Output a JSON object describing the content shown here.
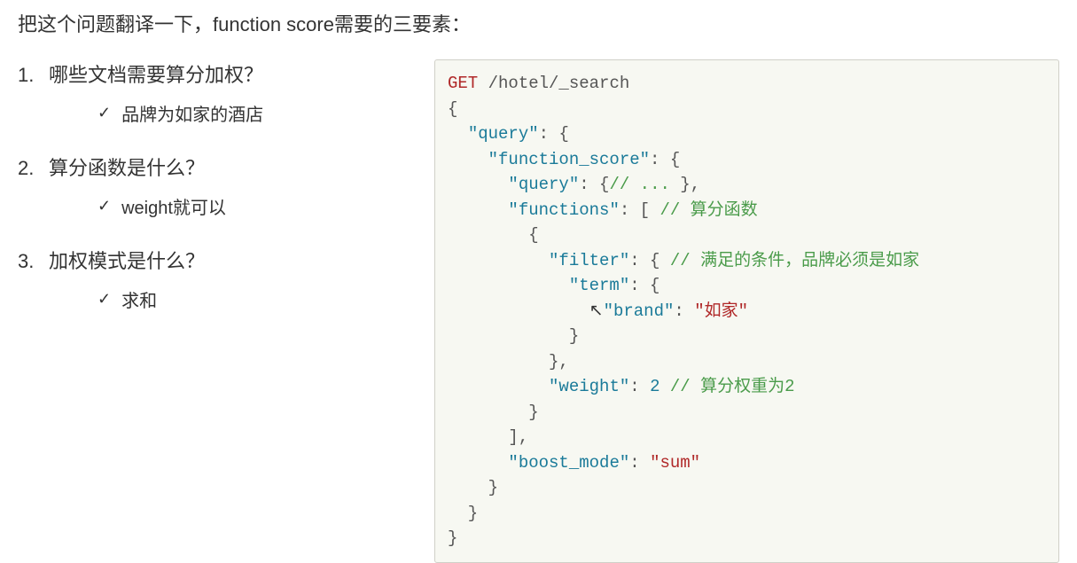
{
  "title": "把这个问题翻译一下，function score需要的三要素：",
  "list": [
    {
      "num": "1.",
      "text": "哪些文档需要算分加权？",
      "sub": "品牌为如家的酒店"
    },
    {
      "num": "2.",
      "text": "算分函数是什么？",
      "sub": "weight就可以"
    },
    {
      "num": "3.",
      "text": "加权模式是什么？",
      "sub": "求和"
    }
  ],
  "code": {
    "l1_method": "GET",
    "l1_path": " /hotel/_search",
    "l2": "{",
    "l3_pre": "  ",
    "l3_key": "\"query\"",
    "l3_post": ": {",
    "l4_pre": "    ",
    "l4_key": "\"function_score\"",
    "l4_post": ": {",
    "l5_pre": "      ",
    "l5_key": "\"query\"",
    "l5_mid": ": {",
    "l5_comment": "// ...",
    "l5_end": " },",
    "l6_pre": "      ",
    "l6_key": "\"functions\"",
    "l6_mid": ": [ ",
    "l6_comment": "// 算分函数",
    "l7": "        {",
    "l8_pre": "          ",
    "l8_key": "\"filter\"",
    "l8_mid": ": { ",
    "l8_comment": "// 满足的条件，品牌必须是如家",
    "l9_pre": "            ",
    "l9_key": "\"term\"",
    "l9_post": ": {",
    "l10_pre": "              ",
    "l10_key": "\"brand\"",
    "l10_mid": ": ",
    "l10_str": "\"如家\"",
    "l11": "            }",
    "l12": "          },",
    "l13_pre": "          ",
    "l13_key": "\"weight\"",
    "l13_mid": ": ",
    "l13_num": "2",
    "l13_sp": " ",
    "l13_comment": "// 算分权重为2",
    "l14": "        }",
    "l15": "      ],",
    "l16_pre": "      ",
    "l16_key": "\"boost_mode\"",
    "l16_mid": ": ",
    "l16_str": "\"sum\"",
    "l17": "    }",
    "l18": "  }",
    "l19": "}"
  }
}
